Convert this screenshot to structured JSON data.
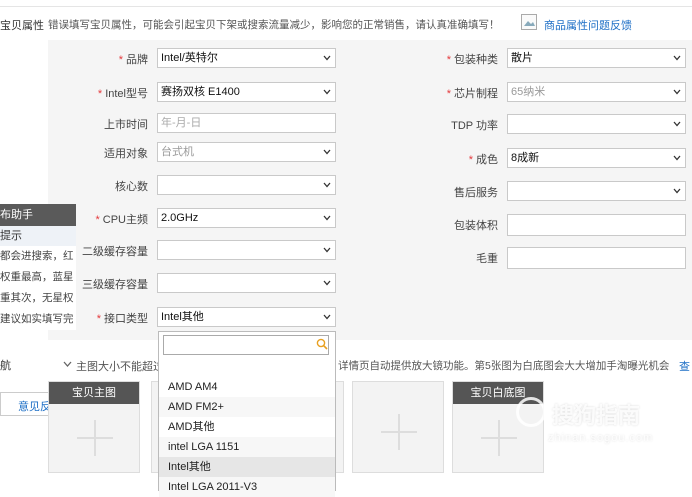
{
  "header": {
    "section_label": "宝贝属性",
    "notice": "错误填写宝贝属性，可能会引起宝贝下架或搜索流量减少，影响您的正常销售，请认真准确填写！",
    "feedback_link": "商品属性问题反馈"
  },
  "left_fields": [
    {
      "label": "品牌",
      "required": true,
      "value": "Intel/英特尔",
      "type": "select"
    },
    {
      "label": "Intel型号",
      "required": true,
      "value": "赛扬双核 E1400",
      "type": "select"
    },
    {
      "label": "上市时间",
      "required": false,
      "value": "",
      "placeholder": "年-月-日",
      "type": "text"
    },
    {
      "label": "适用对象",
      "required": false,
      "value": "台式机",
      "type": "select",
      "disabled": true
    },
    {
      "label": "核心数",
      "required": false,
      "value": "",
      "type": "select"
    },
    {
      "label": "CPU主频",
      "required": true,
      "value": "2.0GHz",
      "type": "select"
    },
    {
      "label": "二级缓存容量",
      "required": false,
      "value": "",
      "type": "select"
    },
    {
      "label": "三级缓存容量",
      "required": false,
      "value": "",
      "type": "select"
    },
    {
      "label": "接口类型",
      "required": true,
      "value": "Intel其他",
      "type": "select"
    }
  ],
  "right_fields": [
    {
      "label": "包装种类",
      "required": true,
      "value": "散片",
      "type": "select"
    },
    {
      "label": "芯片制程",
      "required": true,
      "value": "65纳米",
      "type": "select",
      "disabled": true
    },
    {
      "label": "TDP 功率",
      "required": false,
      "value": "",
      "type": "select"
    },
    {
      "label": "成色",
      "required": true,
      "value": "8成新",
      "type": "select"
    },
    {
      "label": "售后服务",
      "required": false,
      "value": "",
      "type": "select"
    },
    {
      "label": "包装体积",
      "required": false,
      "value": "",
      "type": "text"
    },
    {
      "label": "毛重",
      "required": false,
      "value": "",
      "type": "text"
    }
  ],
  "dropdown": {
    "search_placeholder": "",
    "options": [
      "AMD AM4",
      "AMD FM2+",
      "AMD其他",
      "intel LGA 1151",
      "Intel其他",
      "Intel LGA 2011-V3"
    ],
    "selected": "Intel其他"
  },
  "sidebar": {
    "title": "布助手",
    "tip_heading": "提示",
    "tips": [
      "都会进搜索，红",
      "权重最高，蓝星",
      "重其次，无星权",
      "建议如实填写完"
    ],
    "nav_label": "航",
    "feedback": "意见反馈"
  },
  "images": {
    "hint_left": "主图大小不能超过",
    "hint_right": "详情页自动提供放大镜功能。第5张图为白底图会大大增加手淘曝光机会",
    "hint_link": "查",
    "main_tile_label": "宝贝主图",
    "white_tile_label": "宝贝白底图"
  },
  "watermark": {
    "text": "搜狗指南",
    "url": "zhinan.sogou.com"
  },
  "colors": {
    "required": "#e4393c",
    "link": "#1e6fc6",
    "sidebar_dark": "#5a5a5a"
  }
}
